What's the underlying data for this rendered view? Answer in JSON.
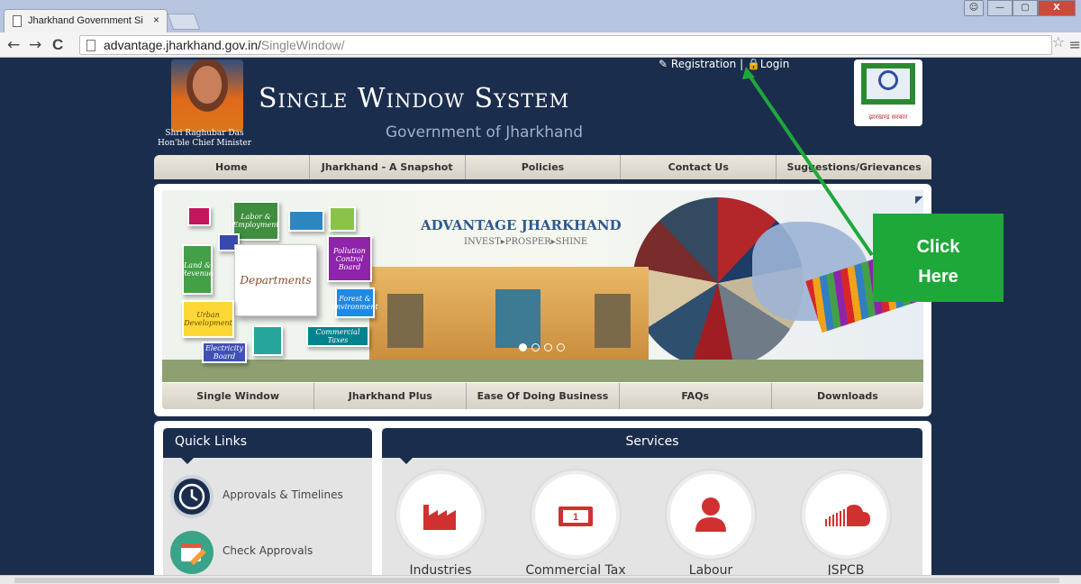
{
  "browser": {
    "tab_title": "Jharkhand Government Si",
    "tab_close": "×",
    "url_domain": "advantage.jharkhand.gov.in/",
    "url_path": "SingleWindow/",
    "back": "←",
    "forward": "→",
    "reload": "C",
    "star": "☆",
    "menu": "≡",
    "window_controls": {
      "minimize": "—",
      "maximize": "▢",
      "close": "X"
    }
  },
  "header": {
    "registration": "Registration",
    "login": "Login",
    "separator": "|",
    "cm_name": "Shri Raghubar Das",
    "cm_title": "Hon'ble Chief Minister",
    "title": "Single Window System",
    "subtitle": "Government of Jharkhand",
    "emblem_text": "झारखण्ड सरकार"
  },
  "main_nav": [
    "Home",
    "Jharkhand - A Snapshot",
    "Policies",
    "Contact Us",
    "Suggestions/Grievances"
  ],
  "banner": {
    "headline": "ADVANTAGE JHARKHAND",
    "tagline": "INVEST▸PROSPER▸SHINE",
    "center_block": "Departments",
    "blocks": [
      "Labor & Employment",
      "Pollution Control Board",
      "Land & Revenue",
      "Forest & environment",
      "Urban Development",
      "Commercial Taxes",
      "Electricity Board"
    ],
    "slide_index": 0,
    "slide_count": 4
  },
  "sub_nav": [
    "Single Window",
    "Jharkhand Plus",
    "Ease Of Doing Business",
    "FAQs",
    "Downloads"
  ],
  "quick_links": {
    "title": "Quick Links",
    "items": [
      {
        "label": "Approvals & Timelines",
        "icon": "clock-icon",
        "color": "#1b2d4c"
      },
      {
        "label": "Check Approvals",
        "icon": "calendar-pencil-icon",
        "color": "#3aa38a"
      }
    ]
  },
  "services": {
    "title": "Services",
    "items": [
      {
        "label": "Industries",
        "icon": "factory-icon",
        "color": "#d0302f"
      },
      {
        "label": "Commercial Tax",
        "icon": "money-icon",
        "color": "#d0302f"
      },
      {
        "label": "Labour",
        "icon": "person-icon",
        "color": "#d0302f"
      },
      {
        "label": "JSPCB",
        "icon": "cloud-icon",
        "color": "#d0302f"
      }
    ]
  },
  "callout": {
    "line1": "Click",
    "line2": "Here",
    "color": "#1fa83a"
  },
  "colors": {
    "page_bg": "#1b2d4c",
    "accent_red": "#d0302f",
    "nav_bg": "#e2ddd2"
  }
}
